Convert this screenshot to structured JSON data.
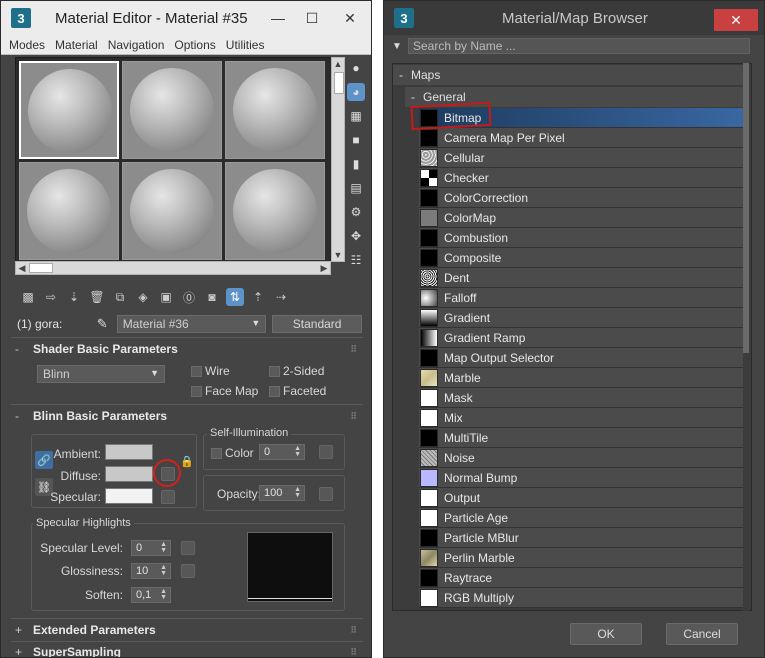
{
  "material_editor": {
    "app_icon": "3",
    "title": "Material Editor - Material #35",
    "menu": [
      "Modes",
      "Material",
      "Navigation",
      "Options",
      "Utilities"
    ],
    "active_material_label": "(1) gora:",
    "material_name": "Material #36",
    "material_type_button": "Standard",
    "shader_basic": {
      "header": "Shader Basic Parameters",
      "shader": "Blinn",
      "wire": "Wire",
      "two_sided": "2-Sided",
      "face_map": "Face Map",
      "faceted": "Faceted"
    },
    "blinn_basic": {
      "header": "Blinn Basic Parameters",
      "self_illum_title": "Self-Illumination",
      "self_illum_color_label": "Color",
      "self_illum_value": "0",
      "ambient_label": "Ambient:",
      "diffuse_label": "Diffuse:",
      "specular_label": "Specular:",
      "opacity_label": "Opacity:",
      "opacity_value": "100",
      "ambient_color": "#c8c8c8",
      "diffuse_color": "#c8c8c8",
      "specular_color": "#f2f2f2"
    },
    "specular_highlights": {
      "title": "Specular Highlights",
      "level_label": "Specular Level:",
      "level_value": "0",
      "gloss_label": "Glossiness:",
      "gloss_value": "10",
      "soften_label": "Soften:",
      "soften_value": "0,1"
    },
    "extended_header": "Extended Parameters",
    "supersampling_header": "SuperSampling"
  },
  "map_browser": {
    "app_icon": "3",
    "title": "Material/Map Browser",
    "search_placeholder": "Search by Name ...",
    "category": "Maps",
    "subcategory": "General",
    "items": [
      {
        "label": "Bitmap",
        "thumb": "black",
        "selected": true
      },
      {
        "label": "Camera Map Per Pixel",
        "thumb": "black"
      },
      {
        "label": "Cellular",
        "thumb": "cellular"
      },
      {
        "label": "Checker",
        "thumb": "checker"
      },
      {
        "label": "ColorCorrection",
        "thumb": "black"
      },
      {
        "label": "ColorMap",
        "thumb": "gray"
      },
      {
        "label": "Combustion",
        "thumb": "black"
      },
      {
        "label": "Composite",
        "thumb": "black"
      },
      {
        "label": "Dent",
        "thumb": "dent"
      },
      {
        "label": "Falloff",
        "thumb": "falloff"
      },
      {
        "label": "Gradient",
        "thumb": "gradient"
      },
      {
        "label": "Gradient Ramp",
        "thumb": "gradient-ramp"
      },
      {
        "label": "Map Output Selector",
        "thumb": "black"
      },
      {
        "label": "Marble",
        "thumb": "marble"
      },
      {
        "label": "Mask",
        "thumb": "white"
      },
      {
        "label": "Mix",
        "thumb": "white"
      },
      {
        "label": "MultiTile",
        "thumb": "black"
      },
      {
        "label": "Noise",
        "thumb": "noise"
      },
      {
        "label": "Normal Bump",
        "thumb": "normal"
      },
      {
        "label": "Output",
        "thumb": "white"
      },
      {
        "label": "Particle Age",
        "thumb": "white"
      },
      {
        "label": "Particle MBlur",
        "thumb": "black"
      },
      {
        "label": "Perlin Marble",
        "thumb": "perlin"
      },
      {
        "label": "Raytrace",
        "thumb": "black"
      },
      {
        "label": "RGB Multiply",
        "thumb": "white"
      }
    ],
    "ok_label": "OK",
    "cancel_label": "Cancel"
  }
}
